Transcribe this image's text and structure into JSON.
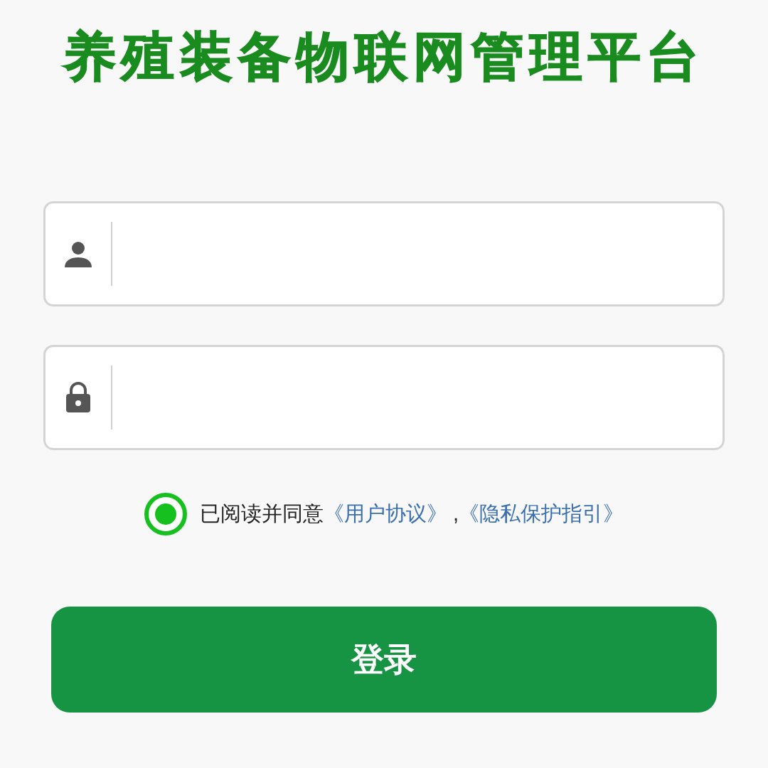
{
  "title": "养殖装备物联网管理平台",
  "fields": [
    {
      "kind": "user"
    },
    {
      "kind": "password"
    }
  ],
  "agreement": {
    "checked": true,
    "text": "已阅读并同意",
    "links": [
      "《用户协议》",
      "《隐私保护指引》"
    ],
    "separator": ","
  },
  "login_button": "登录"
}
